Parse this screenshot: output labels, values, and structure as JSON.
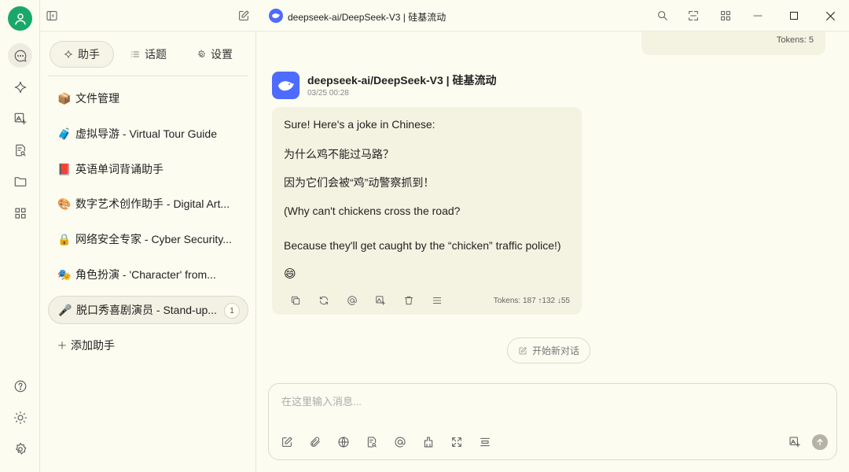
{
  "window": {
    "title": "deepseek-ai/DeepSeek-V3 | 硅基流动"
  },
  "sidebar": {
    "tabs": [
      {
        "label": "助手",
        "icon": "sparkle-icon"
      },
      {
        "label": "话题",
        "icon": "list-icon"
      },
      {
        "label": "设置",
        "icon": "gear-icon"
      }
    ],
    "assistants": [
      {
        "emoji": "📦",
        "label": "文件管理"
      },
      {
        "emoji": "🧳",
        "label": "虚拟导游 - Virtual Tour Guide"
      },
      {
        "emoji": "📕",
        "label": "英语单词背诵助手"
      },
      {
        "emoji": "🎨",
        "label": "数字艺术创作助手 - Digital Art..."
      },
      {
        "emoji": "🔒",
        "label": "网络安全专家 - Cyber Security..."
      },
      {
        "emoji": "🎭",
        "label": "角色扮演 - 'Character' from..."
      },
      {
        "emoji": "🎤",
        "label": "脱口秀喜剧演员 - Stand-up...",
        "badge": "1",
        "selected": true
      }
    ],
    "add_label": "添加助手"
  },
  "chat": {
    "prev_tokens": "Tokens: 5",
    "message": {
      "model": "deepseek-ai/DeepSeek-V3 | 硅基流动",
      "timestamp": "03/25 00:28",
      "lines": [
        "Sure! Here's a joke in Chinese:",
        "为什么鸡不能过马路？",
        "因为它们会被“鸡”动警察抓到！",
        "(Why can't chickens cross the road?",
        "Because they'll get caught by the “chicken” traffic police!)",
        "😄"
      ],
      "tokens": "Tokens: 187 ↑132 ↓55"
    },
    "new_chat_label": "开始新对话",
    "input": {
      "placeholder": "在这里输入消息..."
    }
  },
  "colors": {
    "accent": "#1aa86a",
    "bubble": "#f4f2e1",
    "background": "#fdfcf1",
    "model_icon": "#4d6bfe"
  }
}
